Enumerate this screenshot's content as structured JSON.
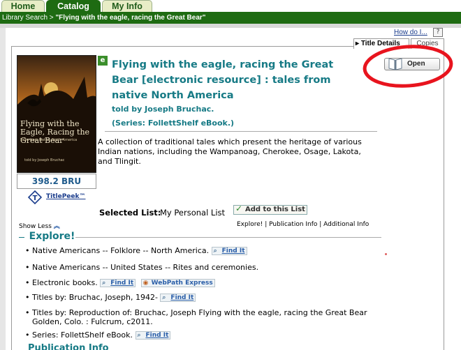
{
  "tabs": [
    {
      "label": "Home",
      "active": false
    },
    {
      "label": "Catalog",
      "active": true
    },
    {
      "label": "My Info",
      "active": false
    }
  ],
  "breadcrumb": {
    "root": "Library Search",
    "separator": " > ",
    "current": "\"Flying with the eagle, racing the Great Bear\""
  },
  "help": {
    "how_do_i": "How do I...",
    "question": "?"
  },
  "subtabs": {
    "details": "Title Details",
    "copies": "Copies"
  },
  "cover": {
    "title": "Flying with the Eagle, Racing the Great Bear",
    "subtitle": "Tales from Native North America",
    "author": "told by Joseph Bruchac",
    "call_number": "398.2 BRU"
  },
  "titlepeek": "TitlePeek™",
  "record": {
    "title": "Flying with the eagle, racing the Great Bear [electronic resource] : tales from native North America",
    "byline": "told by Joseph Bruchac.",
    "series": "(Series: FollettShelf eBook.)",
    "summary": "A collection of traditional tales which present the heritage of various Indian nations, including the Wampanoag, Cherokee, Osage, Lakota, and Tlingit."
  },
  "open_button": "Open",
  "selected_list": {
    "label": "Selected List:",
    "value": "My Personal List",
    "add_button": "Add to this List"
  },
  "show_less": "Show Less",
  "section_links": "Explore! | Publication Info | Additional Info",
  "explore": {
    "heading": "Explore!",
    "items": [
      {
        "text": "Native Americans -- Folklore -- North America.",
        "find_it": "Find It"
      },
      {
        "text": "Native Americans -- United States -- Rites and ceremonies."
      },
      {
        "text": "Electronic books.",
        "find_it": "Find It",
        "webpath": "WebPath Express"
      },
      {
        "text": "Titles by: Bruchac, Joseph, 1942-",
        "find_it": "Find It"
      },
      {
        "text": "Titles by: Reproduction of: Bruchac, Joseph Flying with the eagle, racing the Great Bear Golden, Colo. : Fulcrum, c2011."
      },
      {
        "text": "Series: FollettShelf eBook.",
        "find_it": "Find It"
      }
    ]
  },
  "publication_info_heading": "Publication Info",
  "colors": {
    "brand_green": "#1e6b12",
    "teal_text": "#167a85",
    "link_blue": "#1a3c8c",
    "annotation_red": "#e8141e"
  }
}
